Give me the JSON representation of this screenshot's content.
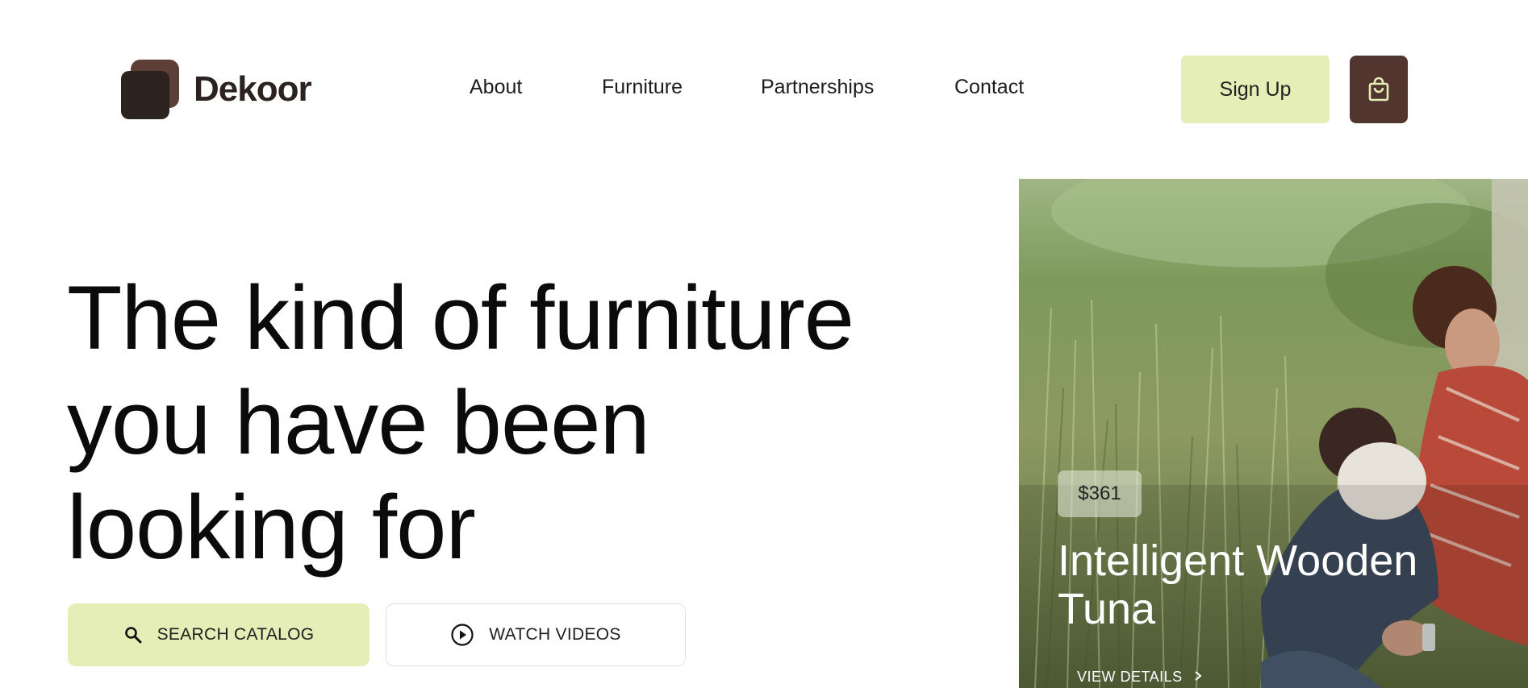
{
  "brand": {
    "name": "Dekoor"
  },
  "nav": {
    "items": [
      {
        "label": "About"
      },
      {
        "label": "Furniture"
      },
      {
        "label": "Partnerships"
      },
      {
        "label": "Contact"
      }
    ]
  },
  "header": {
    "signup_label": "Sign Up",
    "cart_icon": "shopping-bag-icon"
  },
  "hero": {
    "title_lines": [
      "The kind of furniture",
      "you have been",
      "looking for"
    ],
    "search_button_label": "SEARCH CATALOG",
    "search_icon": "search-icon",
    "watch_button_label": "WATCH VIDEOS",
    "watch_icon": "play-circle-icon"
  },
  "product_card": {
    "price": "$361",
    "title": "Intelligent Wooden Tuna",
    "link_label": "VIEW DETAILS",
    "link_icon": "chevron-right-icon"
  },
  "colors": {
    "accent": "#e4eeb6",
    "brand_dark": "#2c2220",
    "brand_brown": "#533530"
  }
}
